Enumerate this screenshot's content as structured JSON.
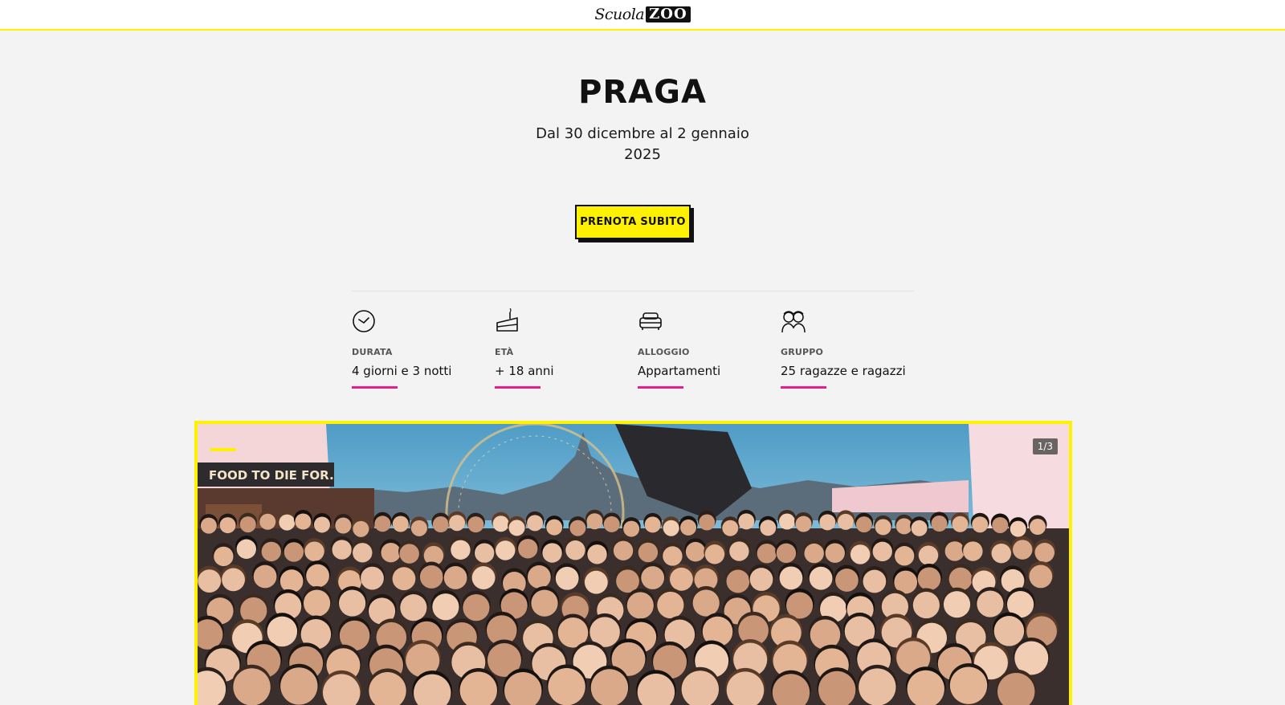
{
  "header": {
    "logo_scuola": "Scuola",
    "logo_zoo": "ZOO"
  },
  "hero": {
    "title": "PRAGA",
    "dates_line1": "Dal 30 dicembre al 2 gennaio",
    "dates_line2": "2025",
    "cta_label": "PRENOTA SUBITO"
  },
  "features": [
    {
      "icon": "clock-icon",
      "title": "DURATA",
      "value": "4 giorni e 3 notti"
    },
    {
      "icon": "cake-icon",
      "title": "ETÀ",
      "value": "+ 18 anni"
    },
    {
      "icon": "bed-icon",
      "title": "ALLOGGIO",
      "value": "Appartamenti"
    },
    {
      "icon": "group-icon",
      "title": "GRUPPO",
      "value": "25 ragazze e ragazzi"
    }
  ],
  "gallery": {
    "pager": "1/3",
    "current": 1,
    "total": 3,
    "sign_text": "FOOD TO DIE FOR."
  },
  "colors": {
    "accent": "#fff200",
    "highlight": "#e91e8c",
    "background": "#f3f3f3"
  }
}
